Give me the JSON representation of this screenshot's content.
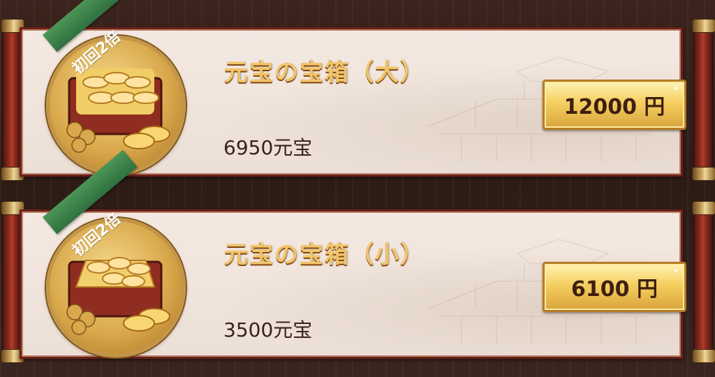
{
  "shop": {
    "packs": [
      {
        "badge": "初回2倍",
        "title": "元宝の宝箱（大）",
        "amount": "6950元宝",
        "price": "12000 円",
        "icon": "large-ingot-chest-icon"
      },
      {
        "badge": "初回2倍",
        "title": "元宝の宝箱（小）",
        "amount": "3500元宝",
        "price": "6100 円",
        "icon": "small-ingot-chest-icon"
      }
    ]
  },
  "colors": {
    "background": "#2d1b16",
    "panel": "#f1e6de",
    "frame": "#6e1f18",
    "title_gold": "#f1c56a",
    "badge_green": "#2f7040",
    "price_button": "#f5cf5f"
  }
}
